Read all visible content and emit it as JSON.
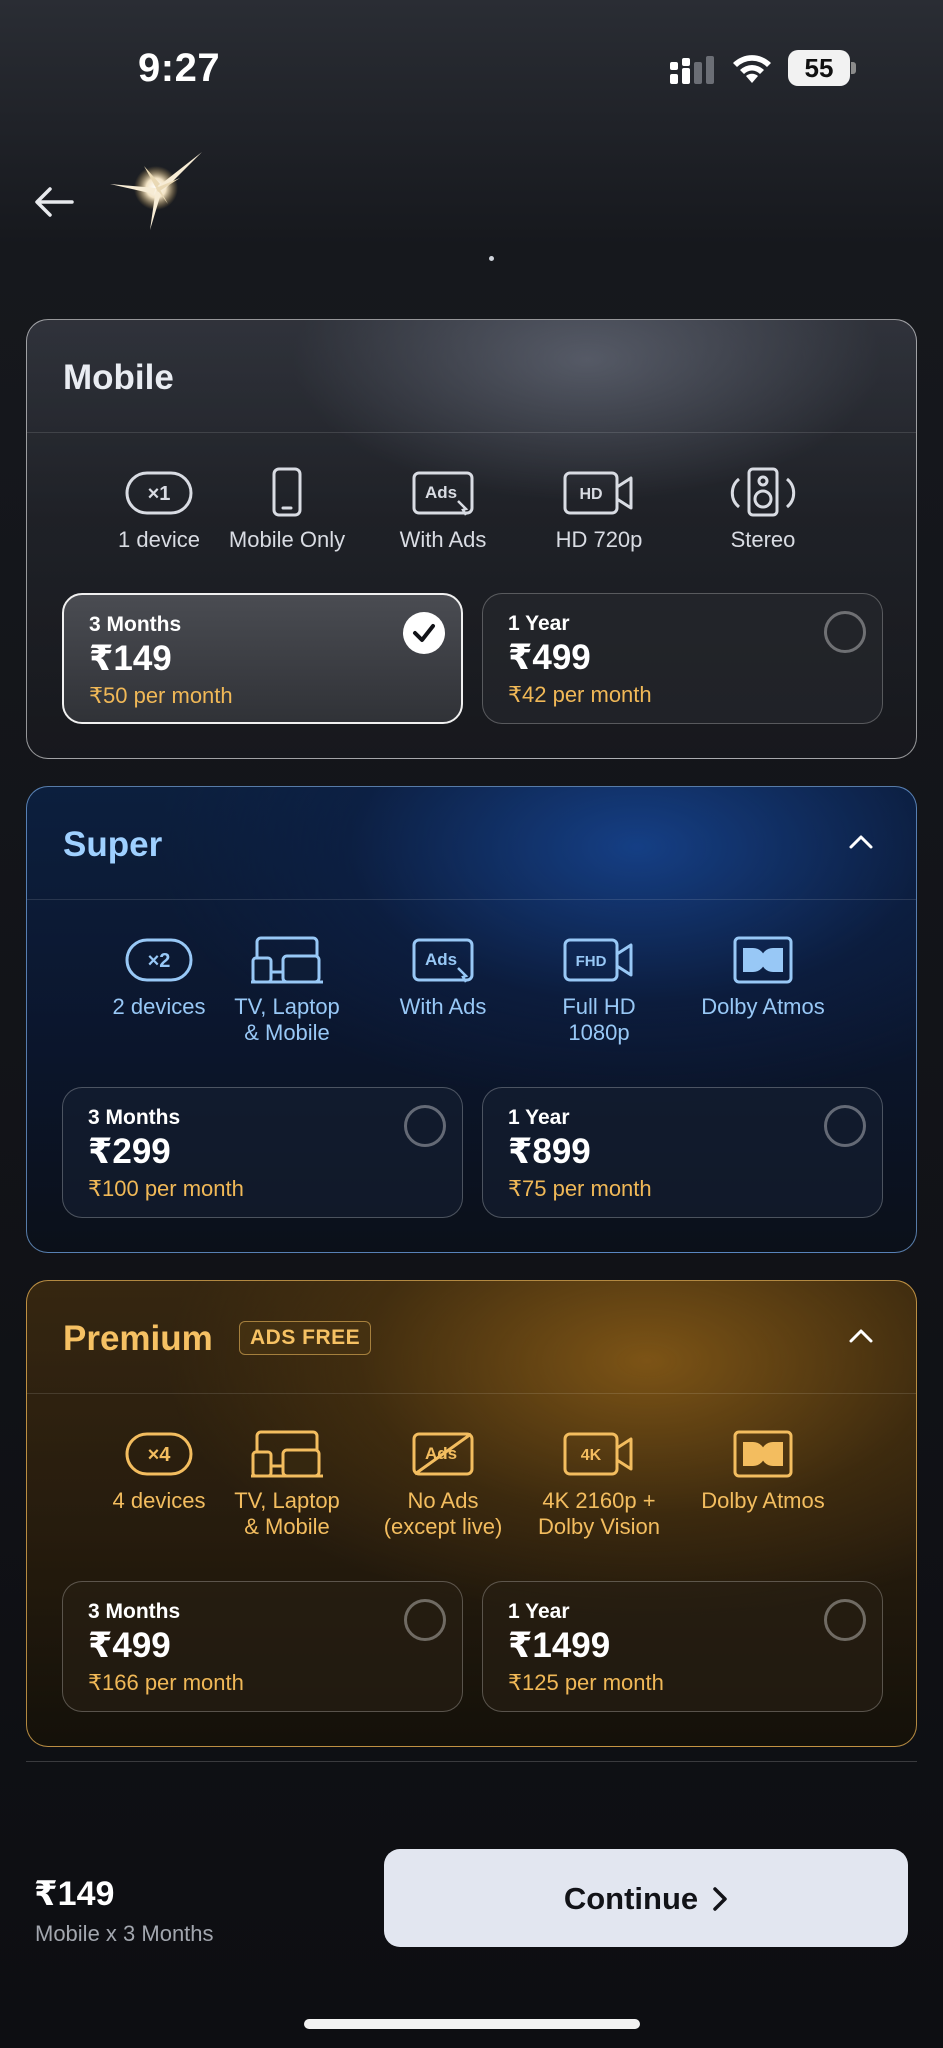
{
  "status_bar": {
    "time": "9:27",
    "battery": "55"
  },
  "plans": [
    {
      "name": "Mobile",
      "features": [
        {
          "icon": "device-count-icon",
          "icon_text": "×1",
          "label": "1 device"
        },
        {
          "icon": "phone-icon",
          "label": "Mobile Only"
        },
        {
          "icon": "ads-icon",
          "icon_text": "Ads",
          "label": "With Ads"
        },
        {
          "icon": "video-camera-icon",
          "icon_text": "HD",
          "label": "HD 720p"
        },
        {
          "icon": "speaker-icon",
          "label": "Stereo"
        }
      ],
      "options": [
        {
          "period": "3 Months",
          "price": "₹149",
          "per_month": "₹50 per month",
          "selected": true
        },
        {
          "period": "1 Year",
          "price": "₹499",
          "per_month": "₹42 per month",
          "selected": false
        }
      ]
    },
    {
      "name": "Super",
      "features": [
        {
          "icon": "device-count-icon",
          "icon_text": "×2",
          "label": "2 devices"
        },
        {
          "icon": "tv-laptop-icon",
          "label": "TV, Laptop\n& Mobile"
        },
        {
          "icon": "ads-icon",
          "icon_text": "Ads",
          "label": "With Ads"
        },
        {
          "icon": "video-camera-icon",
          "icon_text": "FHD",
          "label": "Full HD\n1080p"
        },
        {
          "icon": "dolby-icon",
          "label": "Dolby Atmos"
        }
      ],
      "options": [
        {
          "period": "3 Months",
          "price": "₹299",
          "per_month": "₹100 per month",
          "selected": false
        },
        {
          "period": "1 Year",
          "price": "₹899",
          "per_month": "₹75 per month",
          "selected": false
        }
      ]
    },
    {
      "name": "Premium",
      "badge": "ADS FREE",
      "features": [
        {
          "icon": "device-count-icon",
          "icon_text": "×4",
          "label": "4 devices"
        },
        {
          "icon": "tv-laptop-icon",
          "label": "TV, Laptop\n& Mobile"
        },
        {
          "icon": "no-ads-icon",
          "icon_text": "Ads",
          "label": "No Ads\n(except live)"
        },
        {
          "icon": "video-camera-icon",
          "icon_text": "4K",
          "label": "4K 2160p +\nDolby Vision"
        },
        {
          "icon": "dolby-icon",
          "label": "Dolby Atmos"
        }
      ],
      "options": [
        {
          "period": "3 Months",
          "price": "₹499",
          "per_month": "₹166 per month",
          "selected": false
        },
        {
          "period": "1 Year",
          "price": "₹1499",
          "per_month": "₹125 per month",
          "selected": false
        }
      ]
    }
  ],
  "footer": {
    "price": "₹149",
    "summary": "Mobile x 3 Months",
    "continue_label": "Continue"
  },
  "colors": {
    "accent_gold": "#f6c163",
    "super_blue": "#9fd0ff",
    "per_month_gold": "#f0b857",
    "button_bg": "#e2e6f0"
  }
}
